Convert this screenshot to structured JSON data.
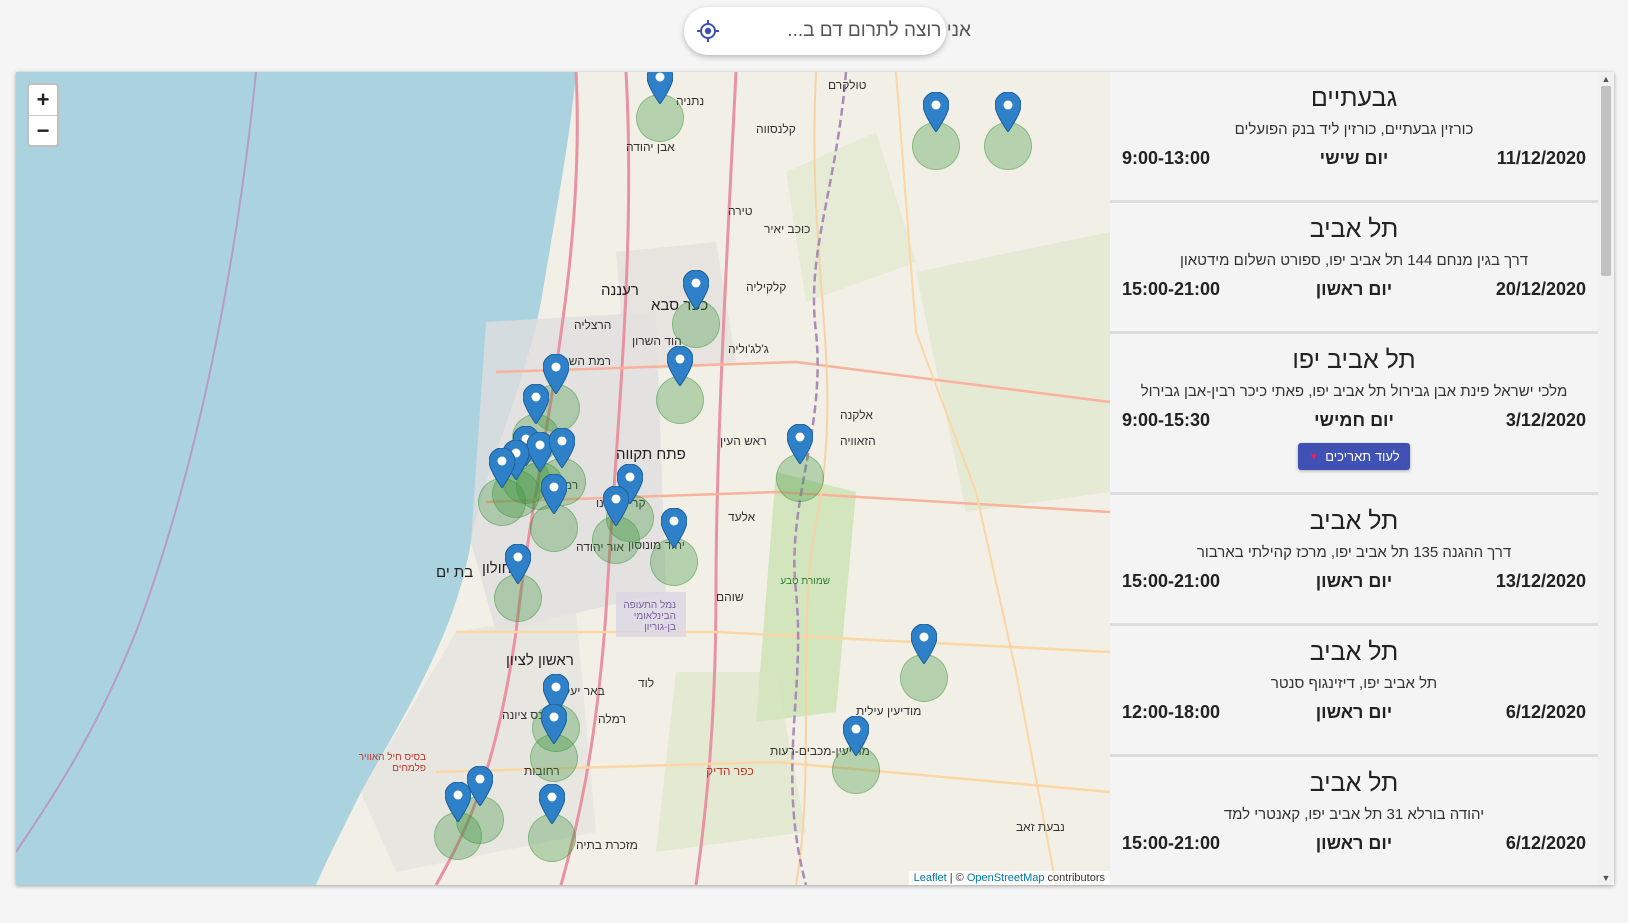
{
  "search": {
    "placeholder": "אני רוצה לתרום דם ב...",
    "icon": "locate-icon",
    "accent": "#3f51b5"
  },
  "map": {
    "zoom_in": "+",
    "zoom_out": "−",
    "attribution": {
      "leaflet": "Leaflet",
      "separator": " | © ",
      "osm": "OpenStreetMap",
      "suffix": " contributors"
    },
    "places": [
      "טולקרם",
      "קלנסווה",
      "נתניה",
      "אבן יהודה",
      "כוכב יאיר",
      "טירה",
      "רעננה",
      "כפר סבא",
      "הרצליה",
      "קלקיליה",
      "רמת השרון",
      "הוד השרון",
      "ג'לג'וליה",
      "פתח תקווה",
      "ראש העין",
      "אלקנה",
      "הזאוויה",
      "רמת גן",
      "קריית אונו",
      "יהוד מונוסון",
      "אור יהודה",
      "אלעד",
      "בת ים",
      "חולון",
      "ראשון לציון",
      "שוהם",
      "נמל התעופה הבינלאומי בן-גוריון",
      "באר יעקב",
      "לוד",
      "רמלה",
      "רחובות",
      "נס ציונה",
      "מודיעין עילית",
      "מודיעין-מכבים-רעות",
      "כפר הדיק",
      "שמורת טבע",
      "נבעת זאב",
      "מזכרת בתיה",
      "בסיס חיל האוויר פלמחים"
    ],
    "markers": 30
  },
  "events": [
    {
      "city": "גבעתיים",
      "address": "כורזין גבעתיים, כורזין ליד בנק הפועלים",
      "date": "11/12/2020",
      "day": "יום שישי",
      "hours": "9:00-13:00"
    },
    {
      "city": "תל אביב",
      "address": "דרך בגין מנחם 144 תל אביב יפו, ספורט השלום מידטאון",
      "date": "20/12/2020",
      "day": "יום ראשון",
      "hours": "15:00-21:00"
    },
    {
      "city": "תל אביב יפו",
      "address": "מלכי ישראל פינת אבן גבירול תל אביב יפו, פאתי כיכר רבין-אבן גבירול",
      "date": "3/12/2020",
      "day": "יום חמישי",
      "hours": "9:00-15:30",
      "more": "לעוד תאריכים"
    },
    {
      "city": "תל אביב",
      "address": "דרך ההגנה 135 תל אביב יפו, מרכז קהילתי בארבור",
      "date": "13/12/2020",
      "day": "יום ראשון",
      "hours": "15:00-21:00"
    },
    {
      "city": "תל אביב",
      "address": "תל אביב יפו, דיזינגוף סנטר",
      "date": "6/12/2020",
      "day": "יום ראשון",
      "hours": "12:00-18:00"
    },
    {
      "city": "תל אביב",
      "address": "יהודה בורלא 31 תל אביב יפו, קאנטרי למד",
      "date": "6/12/2020",
      "day": "יום ראשון",
      "hours": "15:00-21:00"
    }
  ]
}
